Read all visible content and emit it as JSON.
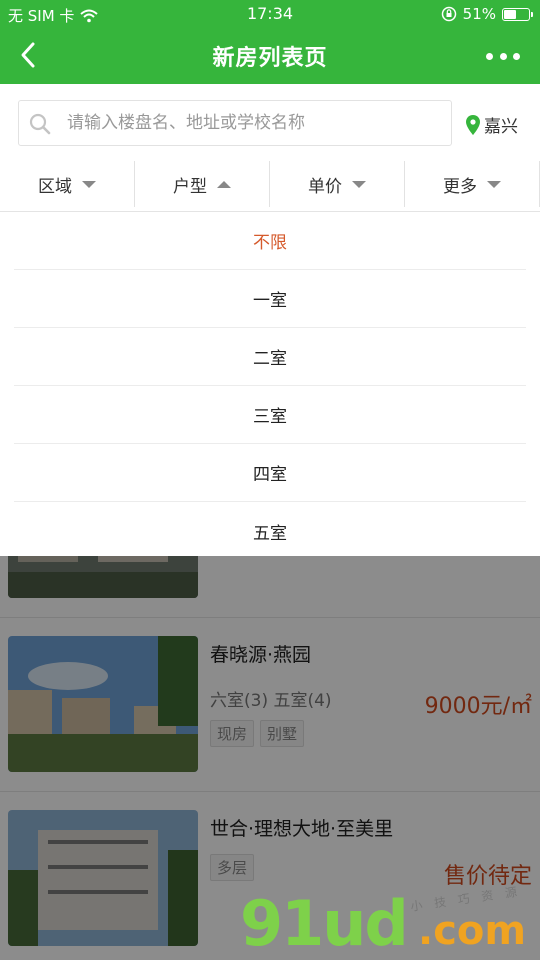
{
  "status_bar": {
    "carrier": "无 SIM 卡",
    "time": "17:34",
    "battery_text": "51%",
    "battery_level": 0.51
  },
  "navbar": {
    "title": "新房列表页"
  },
  "search": {
    "placeholder": "请输入楼盘名、地址或学校名称",
    "city": "嘉兴"
  },
  "filters": [
    {
      "label": "区域",
      "state": "collapsed"
    },
    {
      "label": "户型",
      "state": "expanded"
    },
    {
      "label": "单价",
      "state": "collapsed"
    },
    {
      "label": "更多",
      "state": "collapsed"
    }
  ],
  "dropdown": {
    "options": [
      "不限",
      "一室",
      "二室",
      "三室",
      "四室",
      "五室"
    ],
    "selected": "不限"
  },
  "listings": [
    {
      "name": "",
      "rooms": "",
      "tags": [],
      "price": ""
    },
    {
      "name": "春晓源·燕园",
      "rooms": "六室(3) 五室(4)",
      "tags": [
        "现房",
        "别墅"
      ],
      "price": "9000元/㎡"
    },
    {
      "name": "世合·理想大地·至美里",
      "rooms": "",
      "tags": [
        "多层"
      ],
      "price": "售价待定"
    }
  ],
  "watermark": {
    "main": "91ud",
    "tld": ".com",
    "sub": "小 技 巧 资 源"
  },
  "colors": {
    "brand_green": "#36b53c",
    "price_red": "#d04a1e",
    "active_option": "#d55a2c"
  }
}
